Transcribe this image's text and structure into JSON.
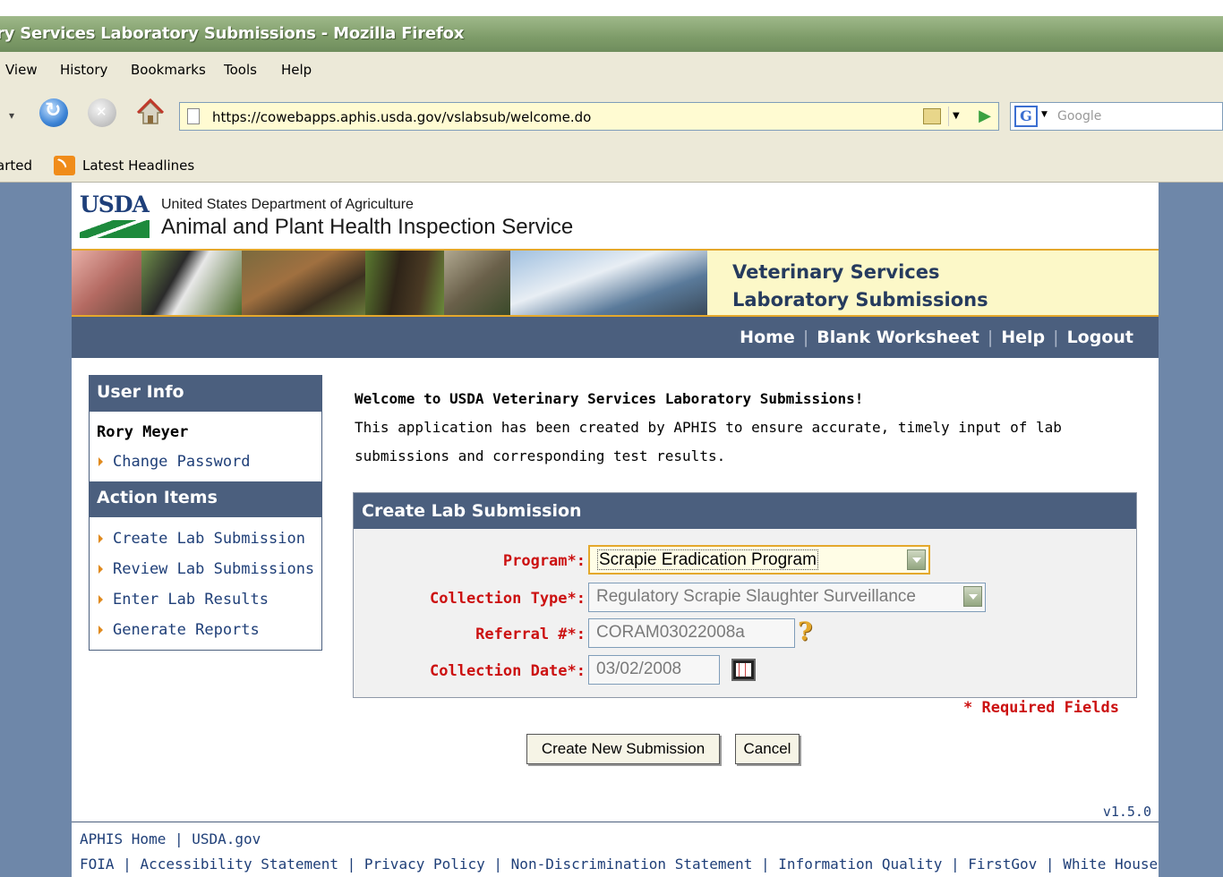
{
  "browser": {
    "window_title": "ry Services Laboratory Submissions - Mozilla Firefox",
    "menu": [
      "View",
      "History",
      "Bookmarks",
      "Tools",
      "Help"
    ],
    "url": "https://cowebapps.aphis.usda.gov/vslabsub/welcome.do",
    "search_placeholder": "Google",
    "bookmarks": [
      "arted",
      "Latest Headlines"
    ]
  },
  "header": {
    "logo_text": "USDA",
    "department": "United States Department of Agriculture",
    "agency": "Animal and Plant Health Inspection Service",
    "banner_line1": "Veterinary Services",
    "banner_line2": "Laboratory Submissions"
  },
  "topnav": [
    "Home",
    "Blank Worksheet",
    "Help",
    "Logout"
  ],
  "sidebar": {
    "user_info_title": "User Info",
    "user_name": "Rory Meyer",
    "change_password": "Change Password",
    "action_items_title": "Action Items",
    "actions": [
      "Create Lab Submission",
      "Review Lab Submissions",
      "Enter Lab Results",
      "Generate Reports"
    ]
  },
  "main": {
    "welcome_heading": "Welcome to USDA Veterinary Services Laboratory Submissions!",
    "welcome_text": "This application has been created by APHIS to ensure accurate, timely input of lab submissions and corresponding test results."
  },
  "form": {
    "title": "Create Lab Submission",
    "program_label": "Program*:",
    "program_value": "Scrapie Eradication Program",
    "collection_type_label": "Collection Type*:",
    "collection_type_value": "Regulatory Scrapie Slaughter Surveillance",
    "referral_label": "Referral #*:",
    "referral_value": "CORAM03022008a",
    "collection_date_label": "Collection Date*:",
    "collection_date_value": "03/02/2008",
    "required_note": "* Required Fields",
    "create_button": "Create New Submission",
    "cancel_button": "Cancel"
  },
  "footer": {
    "version": "v1.5.0",
    "links1": [
      "APHIS Home",
      "USDA.gov"
    ],
    "links2": [
      "FOIA",
      "Accessibility Statement",
      "Privacy Policy",
      "Non-Discrimination Statement",
      "Information Quality",
      "FirstGov",
      "White House"
    ]
  },
  "colors": {
    "nav_blue": "#4b5f7e",
    "page_bg": "#6e87a9",
    "required_red": "#cc1111",
    "accent_orange": "#e4a82c"
  }
}
